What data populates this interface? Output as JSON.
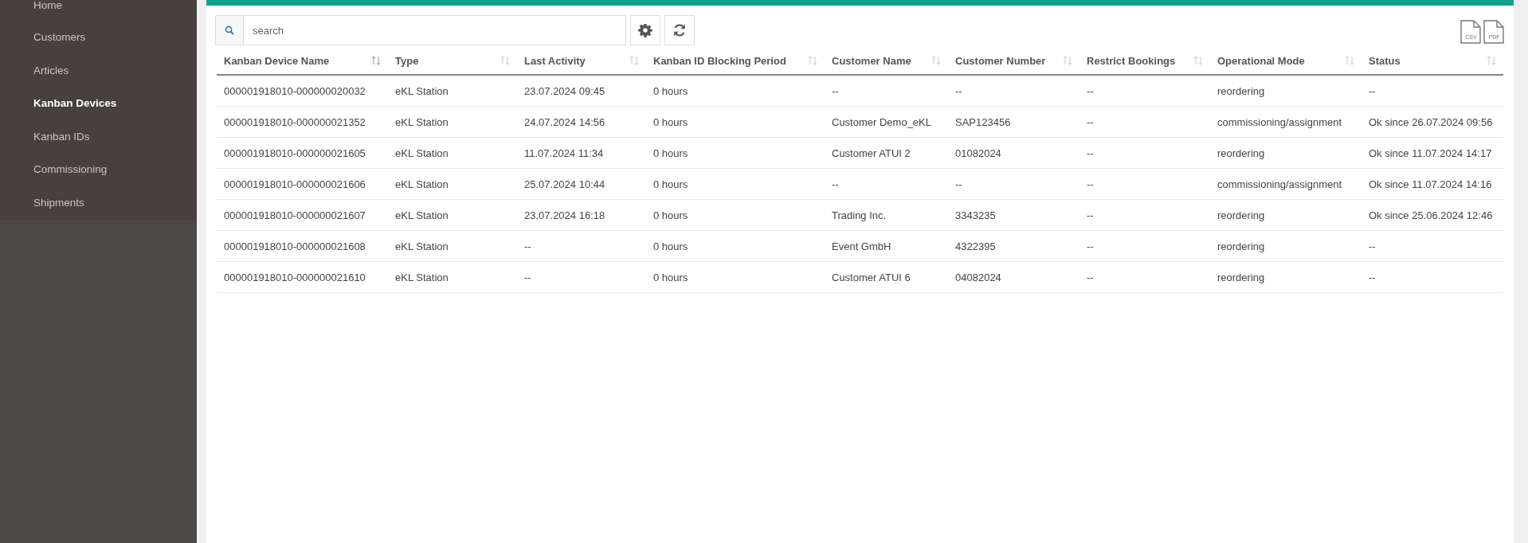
{
  "sidebar": {
    "items": [
      {
        "label": "Home",
        "selected": false
      },
      {
        "label": "Customers",
        "selected": false
      },
      {
        "label": "Articles",
        "selected": false
      },
      {
        "label": "Kanban Devices",
        "selected": true
      },
      {
        "label": "Kanban IDs",
        "selected": false
      },
      {
        "label": "Commissioning",
        "selected": false
      },
      {
        "label": "Shipments",
        "selected": false
      }
    ]
  },
  "search": {
    "placeholder": "search"
  },
  "exports": [
    "CSV",
    "PDF"
  ],
  "table": {
    "columns": [
      {
        "label": "Kanban Device Name",
        "sorted": true
      },
      {
        "label": "Type",
        "sorted": false
      },
      {
        "label": "Last Activity",
        "sorted": false
      },
      {
        "label": "Kanban ID Blocking Period",
        "sorted": false
      },
      {
        "label": "Customer Name",
        "sorted": false
      },
      {
        "label": "Customer Number",
        "sorted": false
      },
      {
        "label": "Restrict Bookings",
        "sorted": false
      },
      {
        "label": "Operational Mode",
        "sorted": false
      },
      {
        "label": "Status",
        "sorted": false
      }
    ],
    "rows": [
      [
        "000001918010-000000020032",
        "eKL Station",
        "23.07.2024 09:45",
        "0 hours",
        "--",
        "--",
        "--",
        "reordering",
        "--"
      ],
      [
        "000001918010-000000021352",
        "eKL Station",
        "24.07.2024 14:56",
        "0 hours",
        "Customer Demo_eKL",
        "SAP123456",
        "--",
        "commissioning/assignment",
        "Ok since 26.07.2024 09:56"
      ],
      [
        "000001918010-000000021605",
        "eKL Station",
        "11.07.2024 11:34",
        "0 hours",
        "Customer ATUI 2",
        "01082024",
        "--",
        "reordering",
        "Ok since 11.07.2024 14:17"
      ],
      [
        "000001918010-000000021606",
        "eKL Station",
        "25.07.2024 10:44",
        "0 hours",
        "--",
        "--",
        "--",
        "commissioning/assignment",
        "Ok since 11.07.2024 14:16"
      ],
      [
        "000001918010-000000021607",
        "eKL Station",
        "23.07.2024 16:18",
        "0 hours",
        "Trading Inc.",
        "3343235",
        "--",
        "reordering",
        "Ok since 25.06.2024 12:46"
      ],
      [
        "000001918010-000000021608",
        "eKL Station",
        "--",
        "0 hours",
        "Event GmbH",
        "4322395",
        "--",
        "reordering",
        "--"
      ],
      [
        "000001918010-000000021610",
        "eKL Station",
        "--",
        "0 hours",
        "Customer ATUI 6",
        "04082024",
        "--",
        "reordering",
        "--"
      ]
    ]
  }
}
